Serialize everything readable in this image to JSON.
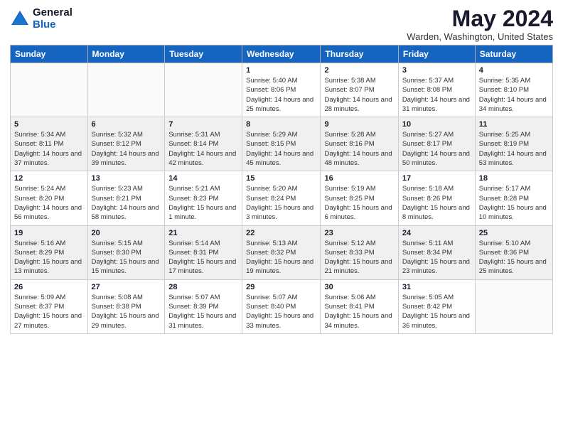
{
  "logo": {
    "general": "General",
    "blue": "Blue"
  },
  "header": {
    "month": "May 2024",
    "location": "Warden, Washington, United States"
  },
  "days_of_week": [
    "Sunday",
    "Monday",
    "Tuesday",
    "Wednesday",
    "Thursday",
    "Friday",
    "Saturday"
  ],
  "weeks": [
    [
      {
        "day": "",
        "info": ""
      },
      {
        "day": "",
        "info": ""
      },
      {
        "day": "",
        "info": ""
      },
      {
        "day": "1",
        "info": "Sunrise: 5:40 AM\nSunset: 8:06 PM\nDaylight: 14 hours and 25 minutes."
      },
      {
        "day": "2",
        "info": "Sunrise: 5:38 AM\nSunset: 8:07 PM\nDaylight: 14 hours and 28 minutes."
      },
      {
        "day": "3",
        "info": "Sunrise: 5:37 AM\nSunset: 8:08 PM\nDaylight: 14 hours and 31 minutes."
      },
      {
        "day": "4",
        "info": "Sunrise: 5:35 AM\nSunset: 8:10 PM\nDaylight: 14 hours and 34 minutes."
      }
    ],
    [
      {
        "day": "5",
        "info": "Sunrise: 5:34 AM\nSunset: 8:11 PM\nDaylight: 14 hours and 37 minutes."
      },
      {
        "day": "6",
        "info": "Sunrise: 5:32 AM\nSunset: 8:12 PM\nDaylight: 14 hours and 39 minutes."
      },
      {
        "day": "7",
        "info": "Sunrise: 5:31 AM\nSunset: 8:14 PM\nDaylight: 14 hours and 42 minutes."
      },
      {
        "day": "8",
        "info": "Sunrise: 5:29 AM\nSunset: 8:15 PM\nDaylight: 14 hours and 45 minutes."
      },
      {
        "day": "9",
        "info": "Sunrise: 5:28 AM\nSunset: 8:16 PM\nDaylight: 14 hours and 48 minutes."
      },
      {
        "day": "10",
        "info": "Sunrise: 5:27 AM\nSunset: 8:17 PM\nDaylight: 14 hours and 50 minutes."
      },
      {
        "day": "11",
        "info": "Sunrise: 5:25 AM\nSunset: 8:19 PM\nDaylight: 14 hours and 53 minutes."
      }
    ],
    [
      {
        "day": "12",
        "info": "Sunrise: 5:24 AM\nSunset: 8:20 PM\nDaylight: 14 hours and 56 minutes."
      },
      {
        "day": "13",
        "info": "Sunrise: 5:23 AM\nSunset: 8:21 PM\nDaylight: 14 hours and 58 minutes."
      },
      {
        "day": "14",
        "info": "Sunrise: 5:21 AM\nSunset: 8:23 PM\nDaylight: 15 hours and 1 minute."
      },
      {
        "day": "15",
        "info": "Sunrise: 5:20 AM\nSunset: 8:24 PM\nDaylight: 15 hours and 3 minutes."
      },
      {
        "day": "16",
        "info": "Sunrise: 5:19 AM\nSunset: 8:25 PM\nDaylight: 15 hours and 6 minutes."
      },
      {
        "day": "17",
        "info": "Sunrise: 5:18 AM\nSunset: 8:26 PM\nDaylight: 15 hours and 8 minutes."
      },
      {
        "day": "18",
        "info": "Sunrise: 5:17 AM\nSunset: 8:28 PM\nDaylight: 15 hours and 10 minutes."
      }
    ],
    [
      {
        "day": "19",
        "info": "Sunrise: 5:16 AM\nSunset: 8:29 PM\nDaylight: 15 hours and 13 minutes."
      },
      {
        "day": "20",
        "info": "Sunrise: 5:15 AM\nSunset: 8:30 PM\nDaylight: 15 hours and 15 minutes."
      },
      {
        "day": "21",
        "info": "Sunrise: 5:14 AM\nSunset: 8:31 PM\nDaylight: 15 hours and 17 minutes."
      },
      {
        "day": "22",
        "info": "Sunrise: 5:13 AM\nSunset: 8:32 PM\nDaylight: 15 hours and 19 minutes."
      },
      {
        "day": "23",
        "info": "Sunrise: 5:12 AM\nSunset: 8:33 PM\nDaylight: 15 hours and 21 minutes."
      },
      {
        "day": "24",
        "info": "Sunrise: 5:11 AM\nSunset: 8:34 PM\nDaylight: 15 hours and 23 minutes."
      },
      {
        "day": "25",
        "info": "Sunrise: 5:10 AM\nSunset: 8:36 PM\nDaylight: 15 hours and 25 minutes."
      }
    ],
    [
      {
        "day": "26",
        "info": "Sunrise: 5:09 AM\nSunset: 8:37 PM\nDaylight: 15 hours and 27 minutes."
      },
      {
        "day": "27",
        "info": "Sunrise: 5:08 AM\nSunset: 8:38 PM\nDaylight: 15 hours and 29 minutes."
      },
      {
        "day": "28",
        "info": "Sunrise: 5:07 AM\nSunset: 8:39 PM\nDaylight: 15 hours and 31 minutes."
      },
      {
        "day": "29",
        "info": "Sunrise: 5:07 AM\nSunset: 8:40 PM\nDaylight: 15 hours and 33 minutes."
      },
      {
        "day": "30",
        "info": "Sunrise: 5:06 AM\nSunset: 8:41 PM\nDaylight: 15 hours and 34 minutes."
      },
      {
        "day": "31",
        "info": "Sunrise: 5:05 AM\nSunset: 8:42 PM\nDaylight: 15 hours and 36 minutes."
      },
      {
        "day": "",
        "info": ""
      }
    ]
  ]
}
